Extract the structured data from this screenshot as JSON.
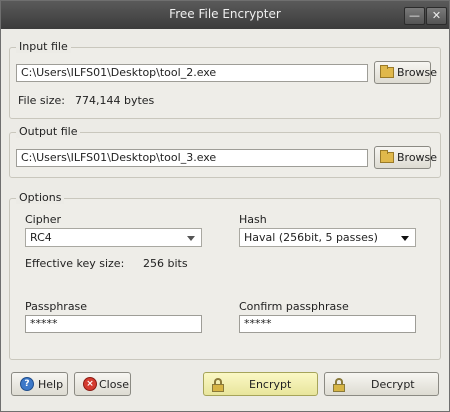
{
  "window": {
    "title": "Free File Encrypter"
  },
  "input_file": {
    "legend": "Input file",
    "path": "C:\\Users\\ILFS01\\Desktop\\tool_2.exe",
    "browse_label": "Browse",
    "size_label": "File size:",
    "size_value": "774,144 bytes"
  },
  "output_file": {
    "legend": "Output file",
    "path": "C:\\Users\\ILFS01\\Desktop\\tool_3.exe",
    "browse_label": "Browse"
  },
  "options": {
    "legend": "Options",
    "cipher_label": "Cipher",
    "cipher_value": "RC4",
    "hash_label": "Hash",
    "hash_value": "Haval (256bit, 5 passes)",
    "key_size_label": "Effective key size:",
    "key_size_value": "256 bits",
    "passphrase_label": "Passphrase",
    "passphrase_value": "*****",
    "confirm_label": "Confirm passphrase",
    "confirm_value": "*****"
  },
  "buttons": {
    "help": "Help",
    "close": "Close",
    "encrypt": "Encrypt",
    "decrypt": "Decrypt"
  },
  "icons": {
    "minimize": "minimize-icon",
    "close_window": "close-window-icon",
    "folder": "folder-icon",
    "help": "help-icon",
    "close": "close-icon",
    "lock": "lock-icon"
  }
}
